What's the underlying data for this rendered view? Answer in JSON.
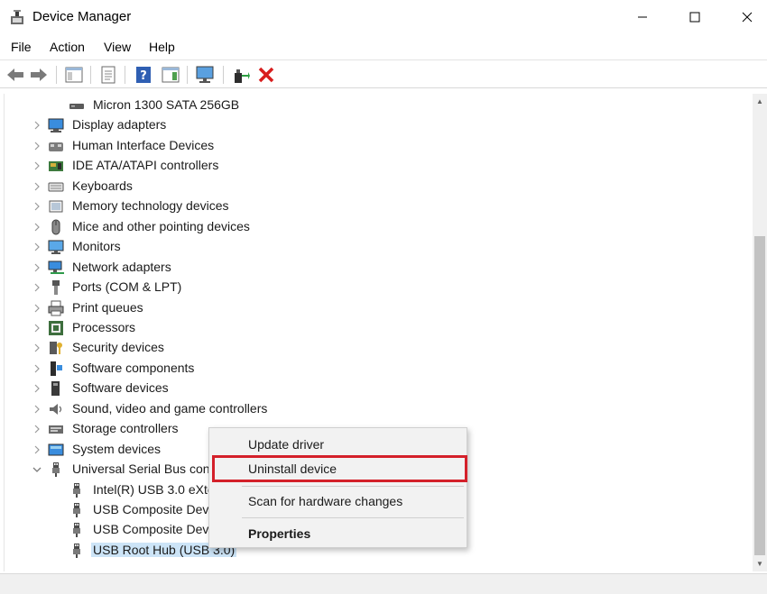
{
  "window": {
    "title": "Device Manager"
  },
  "menubar": {
    "items": [
      "File",
      "Action",
      "View",
      "Help"
    ]
  },
  "toolbar": {
    "buttons": [
      "back-icon",
      "forward-icon",
      "show-hide-console-tree-icon",
      "properties-icon",
      "help-icon",
      "action-pane-icon",
      "monitor-icon",
      "update-driver-icon",
      "uninstall-icon"
    ]
  },
  "tree": {
    "rows": [
      {
        "label": "Micron 1300 SATA 256GB",
        "level": 1,
        "icon": "disk-drive-icon",
        "expander": "none"
      },
      {
        "label": "Display adapters",
        "level": 0,
        "icon": "display-adapter-icon",
        "expander": "collapsed"
      },
      {
        "label": "Human Interface Devices",
        "level": 0,
        "icon": "hid-icon",
        "expander": "collapsed"
      },
      {
        "label": "IDE ATA/ATAPI controllers",
        "level": 0,
        "icon": "ide-controller-icon",
        "expander": "collapsed"
      },
      {
        "label": "Keyboards",
        "level": 0,
        "icon": "keyboard-icon",
        "expander": "collapsed"
      },
      {
        "label": "Memory technology devices",
        "level": 0,
        "icon": "memory-icon",
        "expander": "collapsed"
      },
      {
        "label": "Mice and other pointing devices",
        "level": 0,
        "icon": "mouse-icon",
        "expander": "collapsed"
      },
      {
        "label": "Monitors",
        "level": 0,
        "icon": "monitor-icon",
        "expander": "collapsed"
      },
      {
        "label": "Network adapters",
        "level": 0,
        "icon": "network-adapter-icon",
        "expander": "collapsed"
      },
      {
        "label": "Ports (COM & LPT)",
        "level": 0,
        "icon": "port-icon",
        "expander": "collapsed"
      },
      {
        "label": "Print queues",
        "level": 0,
        "icon": "printer-icon",
        "expander": "collapsed"
      },
      {
        "label": "Processors",
        "level": 0,
        "icon": "processor-icon",
        "expander": "collapsed"
      },
      {
        "label": "Security devices",
        "level": 0,
        "icon": "security-device-icon",
        "expander": "collapsed"
      },
      {
        "label": "Software components",
        "level": 0,
        "icon": "software-component-icon",
        "expander": "collapsed"
      },
      {
        "label": "Software devices",
        "level": 0,
        "icon": "software-device-icon",
        "expander": "collapsed"
      },
      {
        "label": "Sound, video and game controllers",
        "level": 0,
        "icon": "speaker-icon",
        "expander": "collapsed"
      },
      {
        "label": "Storage controllers",
        "level": 0,
        "icon": "storage-controller-icon",
        "expander": "collapsed"
      },
      {
        "label": "System devices",
        "level": 0,
        "icon": "system-device-icon",
        "expander": "collapsed"
      },
      {
        "label": "Universal Serial Bus con",
        "level": 0,
        "icon": "usb-icon",
        "expander": "expanded"
      },
      {
        "label": "Intel(R) USB 3.0 eXte",
        "level": 1,
        "icon": "usb-icon",
        "expander": "none"
      },
      {
        "label": "USB Composite Dev",
        "level": 1,
        "icon": "usb-icon",
        "expander": "none"
      },
      {
        "label": "USB Composite Dev",
        "level": 1,
        "icon": "usb-icon",
        "expander": "none"
      },
      {
        "label": "USB Root Hub (USB 3.0)",
        "level": 1,
        "icon": "usb-icon",
        "expander": "none",
        "selected": true
      }
    ]
  },
  "context_menu": {
    "items": [
      {
        "label": "Update driver",
        "bold": false
      },
      {
        "label": "Uninstall device",
        "bold": false,
        "highlighted": true
      },
      {
        "label": "Scan for hardware changes",
        "bold": false
      },
      {
        "label": "Properties",
        "bold": true
      }
    ]
  },
  "colors": {
    "highlight_border": "#d4202a",
    "selection": "#cce4f7",
    "menu_bg": "#f2f2f2"
  }
}
